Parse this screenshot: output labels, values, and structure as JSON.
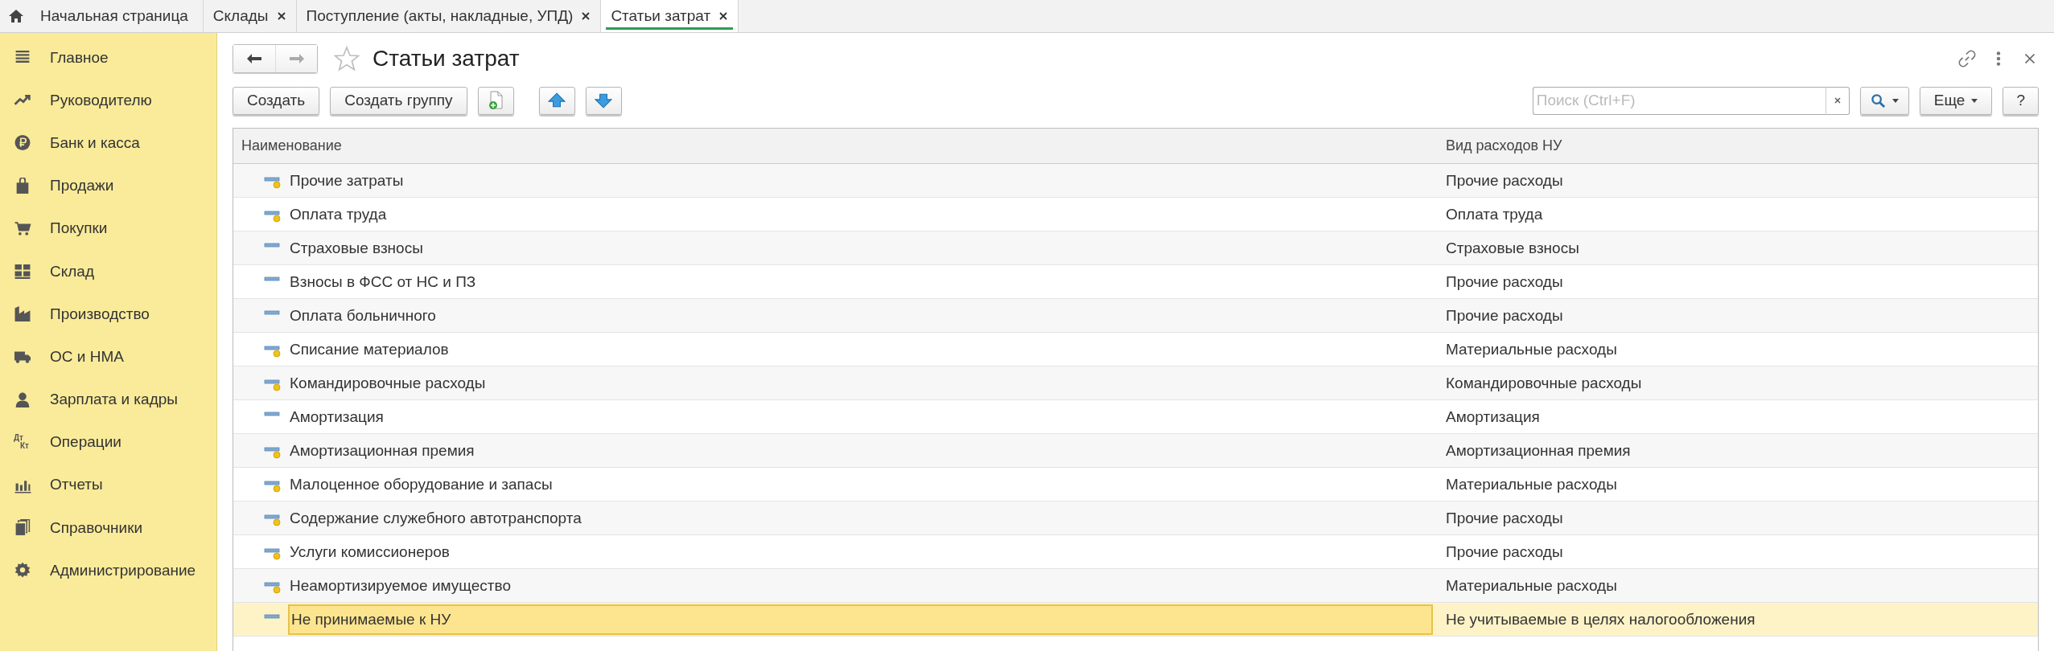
{
  "tabs": [
    {
      "label": "Начальная страница",
      "kind": "home",
      "selected": false
    },
    {
      "label": "Склады",
      "kind": "closable",
      "selected": false
    },
    {
      "label": "Поступление (акты, накладные, УПД)",
      "kind": "closable",
      "selected": false
    },
    {
      "label": "Статьи затрат",
      "kind": "closable",
      "selected": true
    }
  ],
  "sidebar": {
    "items": [
      "Главное",
      "Руководителю",
      "Банк и касса",
      "Продажи",
      "Покупки",
      "Склад",
      "Производство",
      "ОС и НМА",
      "Зарплата и кадры",
      "Операции",
      "Отчеты",
      "Справочники",
      "Администрирование"
    ],
    "operations_icon": {
      "top": "Дт",
      "bottom": "Кт"
    }
  },
  "form": {
    "title": "Статьи затрат",
    "favorite": false,
    "toolbar": {
      "create": "Создать",
      "create_group": "Создать группу",
      "search": {
        "placeholder": "Поиск (Ctrl+F)"
      },
      "more": "Еще",
      "help": "?"
    }
  },
  "table": {
    "columns": [
      "Наименование",
      "Вид расходов НУ"
    ],
    "rows": [
      {
        "name": "Прочие затраты",
        "expense_type": "Прочие расходы",
        "kind": "marked",
        "selected": false
      },
      {
        "name": "Оплата труда",
        "expense_type": "Оплата труда",
        "kind": "marked",
        "selected": false
      },
      {
        "name": "Страховые взносы",
        "expense_type": "Страховые взносы",
        "kind": "plain",
        "selected": false
      },
      {
        "name": "Взносы в ФСС от НС и ПЗ",
        "expense_type": "Прочие расходы",
        "kind": "plain",
        "selected": false
      },
      {
        "name": "Оплата больничного",
        "expense_type": "Прочие расходы",
        "kind": "plain",
        "selected": false
      },
      {
        "name": "Списание материалов",
        "expense_type": "Материальные расходы",
        "kind": "marked",
        "selected": false
      },
      {
        "name": "Командировочные расходы",
        "expense_type": "Командировочные расходы",
        "kind": "marked",
        "selected": false
      },
      {
        "name": "Амортизация",
        "expense_type": "Амортизация",
        "kind": "plain",
        "selected": false
      },
      {
        "name": "Амортизационная премия",
        "expense_type": "Амортизационная премия",
        "kind": "marked",
        "selected": false
      },
      {
        "name": "Малоценное оборудование и запасы",
        "expense_type": "Материальные расходы",
        "kind": "marked",
        "selected": false
      },
      {
        "name": "Содержание служебного автотранспорта",
        "expense_type": "Прочие расходы",
        "kind": "marked",
        "selected": false
      },
      {
        "name": "Услуги комиссионеров",
        "expense_type": "Прочие расходы",
        "kind": "marked",
        "selected": false
      },
      {
        "name": "Неамортизируемое имущество",
        "expense_type": "Материальные расходы",
        "kind": "marked",
        "selected": false
      },
      {
        "name": "Не принимаемые к НУ",
        "expense_type": "Не учитываемые в целях налогообложения",
        "kind": "plain",
        "selected": true
      }
    ]
  }
}
